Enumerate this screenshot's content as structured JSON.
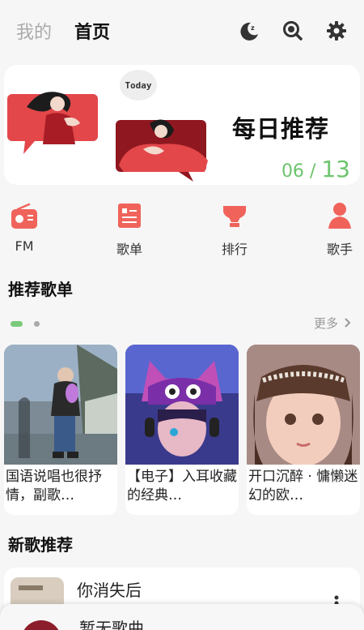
{
  "header": {
    "tab_mine": "我的",
    "tab_home": "首页",
    "icons": [
      "moon-icon",
      "search-icon",
      "gear-icon"
    ]
  },
  "daily": {
    "badge": "Today",
    "title": "每日推荐",
    "month": "06",
    "separator": "/",
    "day": "13",
    "accent": "#6cc46c"
  },
  "quicknav": {
    "items": [
      {
        "label": "FM",
        "icon": "radio-icon"
      },
      {
        "label": "歌单",
        "icon": "playlist-icon"
      },
      {
        "label": "排行",
        "icon": "trophy-icon"
      },
      {
        "label": "歌手",
        "icon": "singer-icon"
      }
    ],
    "color": "#f0635b"
  },
  "recommend": {
    "title": "推荐歌单",
    "more": "更多",
    "playlists": [
      {
        "title": "国语说唱也很抒情，副歌…"
      },
      {
        "title": "【电子】入耳收藏的经典…"
      },
      {
        "title": "开口沉醉 · 慵懒迷幻的欧…"
      }
    ]
  },
  "new_songs": {
    "title": "新歌推荐",
    "items": [
      {
        "name": "你消失后"
      }
    ]
  },
  "player": {
    "title": "暂无歌曲"
  }
}
